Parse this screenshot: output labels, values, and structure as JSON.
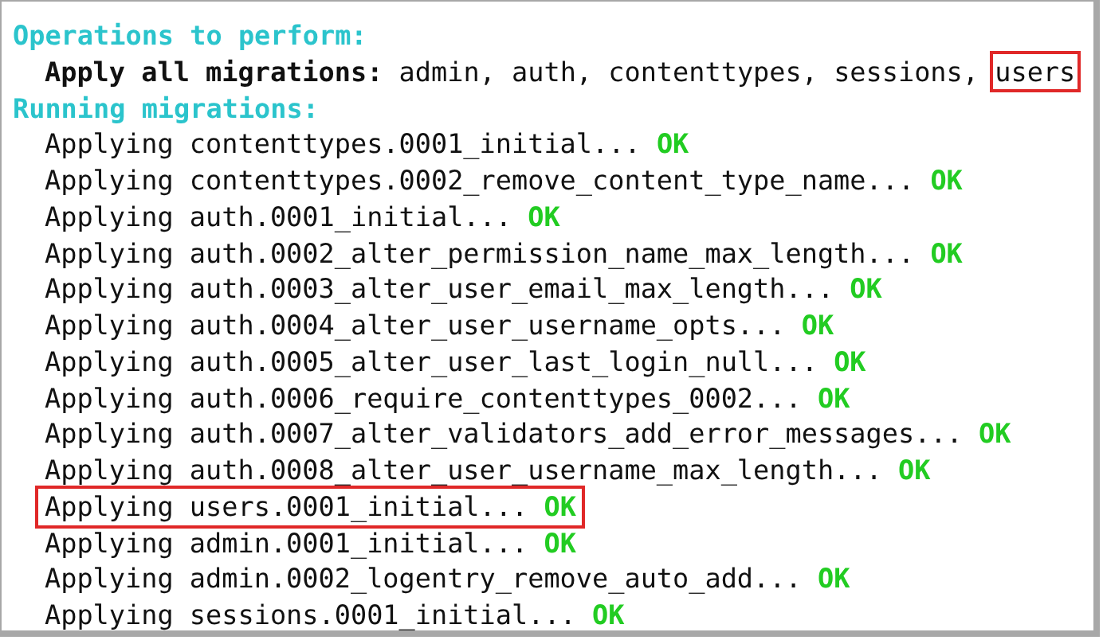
{
  "sections": [
    {
      "heading": "Operations to perform:",
      "lines": [
        {
          "kind": "apply",
          "label": "Apply all migrations:",
          "apps": "admin, auth, contenttypes, sessions,",
          "marked_app": "users"
        }
      ]
    },
    {
      "heading": "Running migrations:",
      "lines": [
        {
          "kind": "migration",
          "text": "Applying contenttypes.0001_initial...",
          "status": "OK",
          "highlighted": false
        },
        {
          "kind": "migration",
          "text": "Applying contenttypes.0002_remove_content_type_name...",
          "status": "OK",
          "highlighted": false
        },
        {
          "kind": "migration",
          "text": "Applying auth.0001_initial...",
          "status": "OK",
          "highlighted": false
        },
        {
          "kind": "migration",
          "text": "Applying auth.0002_alter_permission_name_max_length...",
          "status": "OK",
          "highlighted": false
        },
        {
          "kind": "migration",
          "text": "Applying auth.0003_alter_user_email_max_length...",
          "status": "OK",
          "highlighted": false
        },
        {
          "kind": "migration",
          "text": "Applying auth.0004_alter_user_username_opts...",
          "status": "OK",
          "highlighted": false
        },
        {
          "kind": "migration",
          "text": "Applying auth.0005_alter_user_last_login_null...",
          "status": "OK",
          "highlighted": false
        },
        {
          "kind": "migration",
          "text": "Applying auth.0006_require_contenttypes_0002...",
          "status": "OK",
          "highlighted": false
        },
        {
          "kind": "migration",
          "text": "Applying auth.0007_alter_validators_add_error_messages...",
          "status": "OK",
          "highlighted": false
        },
        {
          "kind": "migration",
          "text": "Applying auth.0008_alter_user_username_max_length...",
          "status": "OK",
          "highlighted": false
        },
        {
          "kind": "migration",
          "text": "Applying users.0001_initial...",
          "status": "OK",
          "highlighted": true
        },
        {
          "kind": "migration",
          "text": "Applying admin.0001_initial...",
          "status": "OK",
          "highlighted": false
        },
        {
          "kind": "migration",
          "text": "Applying admin.0002_logentry_remove_auto_add...",
          "status": "OK",
          "highlighted": false
        },
        {
          "kind": "migration",
          "text": "Applying sessions.0001_initial...",
          "status": "OK",
          "highlighted": false
        }
      ]
    }
  ]
}
